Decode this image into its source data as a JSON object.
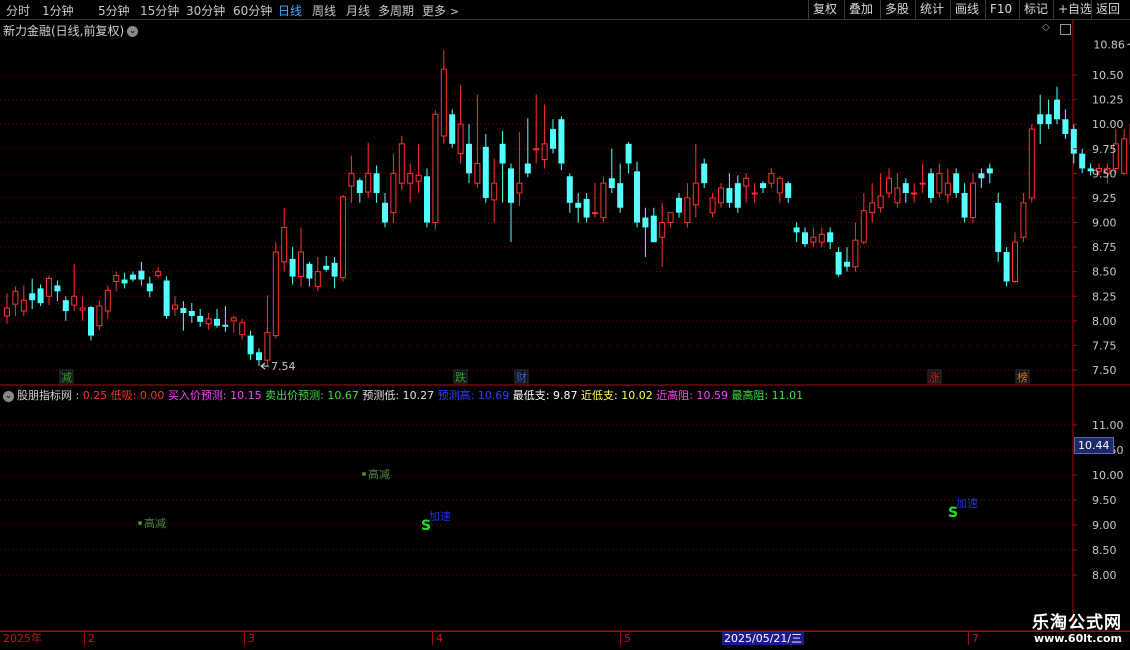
{
  "toolbar": {
    "periods": [
      "分时",
      "1分钟",
      "5分钟",
      "15分钟",
      "30分钟",
      "60分钟",
      "日线",
      "周线",
      "月线",
      "多周期"
    ],
    "active": "日线",
    "more": "更多",
    "right_buttons": [
      "复权",
      "叠加",
      "多股",
      "统计",
      "画线",
      "F10",
      "标记",
      "+自选",
      "返回"
    ]
  },
  "stock_title": "新力金融(日线,前复权)",
  "price_axis": {
    "labels": [
      "10.50",
      "10.25",
      "10.00",
      "9.75",
      "9.50",
      "9.25",
      "9.00",
      "8.75",
      "8.50",
      "8.25",
      "8.00",
      "7.75",
      "7.50"
    ],
    "annot_high": "10.86",
    "annot_low": "7.54"
  },
  "event_markers": [
    {
      "text": "减",
      "color": "#2ea82e"
    },
    {
      "text": "跌",
      "color": "#2ea82e"
    },
    {
      "text": "财",
      "color": "#3a6adf"
    },
    {
      "text": "涨",
      "color": "#d02020"
    },
    {
      "text": "榜",
      "color": "#d07a20"
    }
  ],
  "indicator": {
    "name": "股朋指标网",
    "items": [
      {
        "label": "",
        "value": "0.25",
        "color": "#ff3030"
      },
      {
        "label": "低吸:",
        "value": "0.00",
        "color": "#ff3030"
      },
      {
        "label": "买入价预测:",
        "value": "10.15",
        "color": "#ff40ff"
      },
      {
        "label": "卖出价预测:",
        "value": "10.67",
        "color": "#3adf3a"
      },
      {
        "label": "预测低:",
        "value": "10.27",
        "color": "#e0e0e0"
      },
      {
        "label": "预测高:",
        "value": "10.69",
        "color": "#3040ff"
      },
      {
        "label": "最低支:",
        "value": "9.87",
        "color": "#ffffff"
      },
      {
        "label": "近低支:",
        "value": "10.02",
        "color": "#ffff40"
      },
      {
        "label": "近高阻:",
        "value": "10.59",
        "color": "#ff40ff"
      },
      {
        "label": "最高阻:",
        "value": "11.01",
        "color": "#3adf3a"
      }
    ],
    "axis_labels": [
      "11.00",
      "10.50",
      "10.00",
      "9.50",
      "9.00",
      "8.50",
      "8.00"
    ],
    "current_price": "10.44",
    "signals": [
      {
        "text": "高减",
        "kind": "dot"
      },
      {
        "text": "高减",
        "kind": "dot"
      },
      {
        "text": "加速",
        "kind": "s"
      },
      {
        "text": "加速",
        "kind": "s"
      }
    ],
    "s_glyph": "S"
  },
  "timeline": {
    "labels": [
      "2025年",
      "2",
      "3",
      "4",
      "5",
      "7"
    ],
    "cursor_date": "2025/05/21/三"
  },
  "watermark": {
    "cn": "乐淘公式网",
    "url": "www.60lt.com"
  },
  "colors": {
    "up": "#ff3232",
    "down": "#54ffff",
    "grid": "#8a0000",
    "bg": "#000000"
  },
  "chart_data": {
    "type": "candlestick",
    "ylim": [
      7.4,
      10.95
    ],
    "candles": [
      [
        8.05,
        8.13,
        8.28,
        7.97
      ],
      [
        8.17,
        8.3,
        8.35,
        8.05
      ],
      [
        8.1,
        8.21,
        8.36,
        8.05
      ],
      [
        8.28,
        8.21,
        8.43,
        8.12
      ],
      [
        8.33,
        8.18,
        8.37,
        8.15
      ],
      [
        8.25,
        8.43,
        8.46,
        8.16
      ],
      [
        8.36,
        8.3,
        8.41,
        8.2
      ],
      [
        8.21,
        8.1,
        8.25,
        8.0
      ],
      [
        8.16,
        8.25,
        8.58,
        8.1
      ],
      [
        8.11,
        8.13,
        8.25,
        8.0
      ],
      [
        8.14,
        7.85,
        8.15,
        7.8
      ],
      [
        7.95,
        8.15,
        8.21,
        7.91
      ],
      [
        8.1,
        8.31,
        8.36,
        8.02
      ],
      [
        8.4,
        8.46,
        8.5,
        8.3
      ],
      [
        8.42,
        8.38,
        8.49,
        8.33
      ],
      [
        8.47,
        8.42,
        8.5,
        8.4
      ],
      [
        8.51,
        8.42,
        8.6,
        8.36
      ],
      [
        8.38,
        8.3,
        8.45,
        8.24
      ],
      [
        8.46,
        8.5,
        8.55,
        8.44
      ],
      [
        8.41,
        8.05,
        8.45,
        8.02
      ],
      [
        8.12,
        8.16,
        8.25,
        8.05
      ],
      [
        8.13,
        8.08,
        8.2,
        7.9
      ],
      [
        8.1,
        8.05,
        8.18,
        7.98
      ],
      [
        8.05,
        7.99,
        8.12,
        7.94
      ],
      [
        7.97,
        8.02,
        8.08,
        7.91
      ],
      [
        8.02,
        7.95,
        8.12,
        7.93
      ],
      [
        7.96,
        7.94,
        8.15,
        7.89
      ],
      [
        8.0,
        8.03,
        8.05,
        7.88
      ],
      [
        7.86,
        7.98,
        8.02,
        7.81
      ],
      [
        7.85,
        7.66,
        7.9,
        7.6
      ],
      [
        7.68,
        7.6,
        7.72,
        7.54
      ],
      [
        7.6,
        7.88,
        8.26,
        7.55
      ],
      [
        7.85,
        8.7,
        8.8,
        7.82
      ],
      [
        8.6,
        8.95,
        9.15,
        8.5
      ],
      [
        8.63,
        8.45,
        8.75,
        8.37
      ],
      [
        8.45,
        8.7,
        8.95,
        8.35
      ],
      [
        8.58,
        8.43,
        8.6,
        8.35
      ],
      [
        8.35,
        8.5,
        8.65,
        8.3
      ],
      [
        8.56,
        8.52,
        8.66,
        8.5
      ],
      [
        8.59,
        8.45,
        8.65,
        8.33
      ],
      [
        8.44,
        9.26,
        9.28,
        8.4
      ],
      [
        9.37,
        9.5,
        9.68,
        9.2
      ],
      [
        9.43,
        9.3,
        9.45,
        9.2
      ],
      [
        9.31,
        9.5,
        9.81,
        9.25
      ],
      [
        9.5,
        9.3,
        9.58,
        9.2
      ],
      [
        9.2,
        9.0,
        9.3,
        8.95
      ],
      [
        9.1,
        9.5,
        9.7,
        9.0
      ],
      [
        9.4,
        9.8,
        9.88,
        9.33
      ],
      [
        9.4,
        9.5,
        9.6,
        9.2
      ],
      [
        9.42,
        9.48,
        9.8,
        9.3
      ],
      [
        9.47,
        9.0,
        9.55,
        8.95
      ],
      [
        9.0,
        10.1,
        10.14,
        8.93
      ],
      [
        9.88,
        10.56,
        10.75,
        9.8
      ],
      [
        10.1,
        9.8,
        10.15,
        9.76
      ],
      [
        9.7,
        10.0,
        10.4,
        9.6
      ],
      [
        9.8,
        9.5,
        10.0,
        9.4
      ],
      [
        9.4,
        9.6,
        10.3,
        9.35
      ],
      [
        9.77,
        9.25,
        9.9,
        9.2
      ],
      [
        9.23,
        9.4,
        9.65,
        9.0
      ],
      [
        9.8,
        9.6,
        9.93,
        9.2
      ],
      [
        9.55,
        9.2,
        9.6,
        8.8
      ],
      [
        9.3,
        9.4,
        9.92,
        9.17
      ],
      [
        9.6,
        9.5,
        10.06,
        9.46
      ],
      [
        9.74,
        9.75,
        10.3,
        9.6
      ],
      [
        9.64,
        9.8,
        10.2,
        9.55
      ],
      [
        9.95,
        9.75,
        10.05,
        9.7
      ],
      [
        10.05,
        9.6,
        10.08,
        9.53
      ],
      [
        9.47,
        9.2,
        9.5,
        9.1
      ],
      [
        9.2,
        9.15,
        9.3,
        9.0
      ],
      [
        9.24,
        9.05,
        9.3,
        9.0
      ],
      [
        9.1,
        9.1,
        9.4,
        9.05
      ],
      [
        9.05,
        9.4,
        9.47,
        9.0
      ],
      [
        9.45,
        9.35,
        9.75,
        9.3
      ],
      [
        9.4,
        9.15,
        9.6,
        9.1
      ],
      [
        9.8,
        9.6,
        9.82,
        9.5
      ],
      [
        9.52,
        9.0,
        9.62,
        8.95
      ],
      [
        9.05,
        8.95,
        9.15,
        8.65
      ],
      [
        9.07,
        8.8,
        9.15,
        8.8
      ],
      [
        8.85,
        9.0,
        9.2,
        8.55
      ],
      [
        9.0,
        9.1,
        9.1,
        8.95
      ],
      [
        9.25,
        9.1,
        9.3,
        9.05
      ],
      [
        9.0,
        9.25,
        9.4,
        8.95
      ],
      [
        9.18,
        9.4,
        9.8,
        9.05
      ],
      [
        9.6,
        9.4,
        9.65,
        9.35
      ],
      [
        9.1,
        9.25,
        9.3,
        9.05
      ],
      [
        9.2,
        9.35,
        9.4,
        9.15
      ],
      [
        9.35,
        9.2,
        9.5,
        9.15
      ],
      [
        9.4,
        9.15,
        9.48,
        9.1
      ],
      [
        9.37,
        9.45,
        9.5,
        9.2
      ],
      [
        9.3,
        9.3,
        9.4,
        9.2
      ],
      [
        9.4,
        9.35,
        9.42,
        9.3
      ],
      [
        9.4,
        9.5,
        9.55,
        9.35
      ],
      [
        9.3,
        9.45,
        9.47,
        9.2
      ],
      [
        9.4,
        9.25,
        9.42,
        9.2
      ],
      [
        8.95,
        8.9,
        9.0,
        8.8
      ],
      [
        8.9,
        8.78,
        8.95,
        8.75
      ],
      [
        8.8,
        8.85,
        8.95,
        8.75
      ],
      [
        8.8,
        8.88,
        8.95,
        8.75
      ],
      [
        8.9,
        8.8,
        8.95,
        8.73
      ],
      [
        8.7,
        8.47,
        8.75,
        8.45
      ],
      [
        8.6,
        8.55,
        8.75,
        8.5
      ],
      [
        8.55,
        8.82,
        9.0,
        8.5
      ],
      [
        8.8,
        9.12,
        9.3,
        8.78
      ],
      [
        9.1,
        9.2,
        9.4,
        9.0
      ],
      [
        9.15,
        9.27,
        9.5,
        9.1
      ],
      [
        9.3,
        9.45,
        9.55,
        9.25
      ],
      [
        9.2,
        9.35,
        9.5,
        9.15
      ],
      [
        9.4,
        9.3,
        9.45,
        9.2
      ],
      [
        9.3,
        9.3,
        9.4,
        9.2
      ],
      [
        9.4,
        9.4,
        9.6,
        9.3
      ],
      [
        9.5,
        9.25,
        9.55,
        9.2
      ],
      [
        9.3,
        9.5,
        9.6,
        9.25
      ],
      [
        9.28,
        9.4,
        9.55,
        9.2
      ],
      [
        9.5,
        9.3,
        9.55,
        9.25
      ],
      [
        9.3,
        9.05,
        9.4,
        9.0
      ],
      [
        9.05,
        9.4,
        9.5,
        9.0
      ],
      [
        9.5,
        9.45,
        9.55,
        9.35
      ],
      [
        9.55,
        9.5,
        9.6,
        9.4
      ],
      [
        9.2,
        8.7,
        9.3,
        8.6
      ],
      [
        8.7,
        8.4,
        8.75,
        8.35
      ],
      [
        8.4,
        8.8,
        8.9,
        8.38
      ],
      [
        8.85,
        9.2,
        9.3,
        8.8
      ],
      [
        9.25,
        9.95,
        10.0,
        9.2
      ],
      [
        10.1,
        10.0,
        10.3,
        9.8
      ],
      [
        10.1,
        10.0,
        10.25,
        9.95
      ],
      [
        10.25,
        10.05,
        10.38,
        10.0
      ],
      [
        10.05,
        9.9,
        10.15,
        9.85
      ],
      [
        9.95,
        9.7,
        10.0,
        9.6
      ],
      [
        9.7,
        9.55,
        9.75,
        9.5
      ],
      [
        9.55,
        9.52,
        9.6,
        9.48
      ],
      [
        9.52,
        9.55,
        9.6,
        9.48
      ],
      [
        9.5,
        9.55,
        9.6,
        9.4
      ],
      [
        9.55,
        9.8,
        9.95,
        9.5
      ],
      [
        9.5,
        9.85,
        9.95,
        9.48
      ],
      [
        9.8,
        10.0,
        10.1,
        9.75
      ],
      [
        10.0,
        10.35,
        10.4,
        9.95
      ],
      [
        10.0,
        10.45,
        10.86,
        9.98
      ],
      [
        10.45,
        10.34,
        10.55,
        10.3
      ]
    ]
  }
}
